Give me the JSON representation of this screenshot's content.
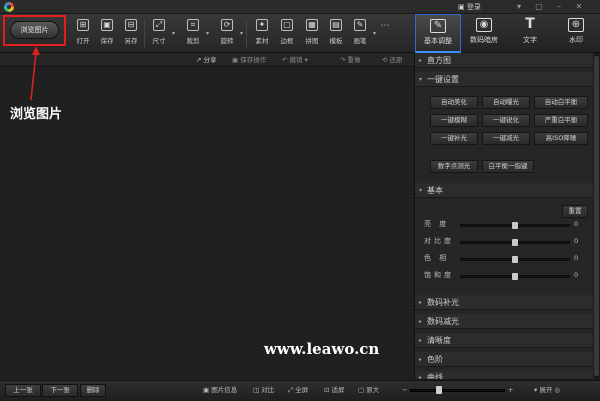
{
  "titlebar": {
    "login_label": "登录",
    "controls": [
      "▾",
      "▢",
      "–",
      "✕"
    ]
  },
  "toolbar": {
    "browse_label": "浏览图片",
    "tools": [
      {
        "icon": "open-icon",
        "glyph": "⊞",
        "label": "打开"
      },
      {
        "icon": "save-icon",
        "glyph": "▣",
        "label": "保存"
      },
      {
        "icon": "save-as-icon",
        "glyph": "⊟",
        "label": "另存"
      },
      {
        "icon": "resize-icon",
        "glyph": "⤢",
        "label": "尺寸"
      },
      {
        "icon": "crop-icon",
        "glyph": "⌗",
        "label": "裁剪"
      },
      {
        "icon": "rotate-icon",
        "glyph": "⟳",
        "label": "旋转"
      },
      {
        "icon": "material-icon",
        "glyph": "✦",
        "label": "素材"
      },
      {
        "icon": "border-icon",
        "glyph": "▢",
        "label": "边框"
      },
      {
        "icon": "collage-icon",
        "glyph": "▦",
        "label": "拼图"
      },
      {
        "icon": "template-icon",
        "glyph": "▤",
        "label": "模板"
      },
      {
        "icon": "paint-icon",
        "glyph": "✎",
        "label": "画笔"
      },
      {
        "icon": "more-icon",
        "glyph": "⋯",
        "label": ""
      }
    ]
  },
  "action_bar": {
    "share": "分享",
    "save_action": "保存操作",
    "undo": "撤销",
    "redo": "重做",
    "clear": "还原"
  },
  "annotation": {
    "label": "浏览图片",
    "watermark": "www.leawo.cn"
  },
  "right_tabs": [
    {
      "icon": "adjust-icon",
      "glyph": "✎",
      "label": "基本调整"
    },
    {
      "icon": "camera-icon",
      "glyph": "◉",
      "label": "数码暗房"
    },
    {
      "icon": "text-icon",
      "glyph": "T",
      "label": "文字"
    },
    {
      "icon": "watermark-icon",
      "glyph": "⊕",
      "label": "水印"
    }
  ],
  "panel": {
    "histogram": "直方图",
    "one_click": "一键设置",
    "one_click_buttons": [
      [
        "自动美化",
        "自动曝光",
        "自动白平衡"
      ],
      [
        "一键模糊",
        "一键锐化",
        "严重白平衡"
      ],
      [
        "一键补光",
        "一键减光",
        "高ISO降噪"
      ]
    ],
    "extra_buttons": [
      "数字点测光",
      "白平衡一指键"
    ],
    "basic": "基本",
    "reset": "重置",
    "sliders": [
      {
        "label": "亮 度",
        "value": "0",
        "level": 0.5
      },
      {
        "label": "对比度",
        "value": "0",
        "level": 0.5
      },
      {
        "label": "色 相",
        "value": "0",
        "level": 0.5
      },
      {
        "label": "饱和度",
        "value": "0",
        "level": 0.5
      }
    ],
    "more_sections": [
      "数码补光",
      "数码减光",
      "清晰度",
      "色阶",
      "曲线"
    ]
  },
  "statusbar": {
    "prev": "上一张",
    "next": "下一张",
    "delete": "删除",
    "info": "图片信息",
    "compare": "对比",
    "fullscreen": "全屏",
    "fit": "适屏",
    "original": "原大",
    "zoom_minus": "−",
    "zoom_plus": "+",
    "expand": "展开",
    "zoom_level": 0.3
  }
}
